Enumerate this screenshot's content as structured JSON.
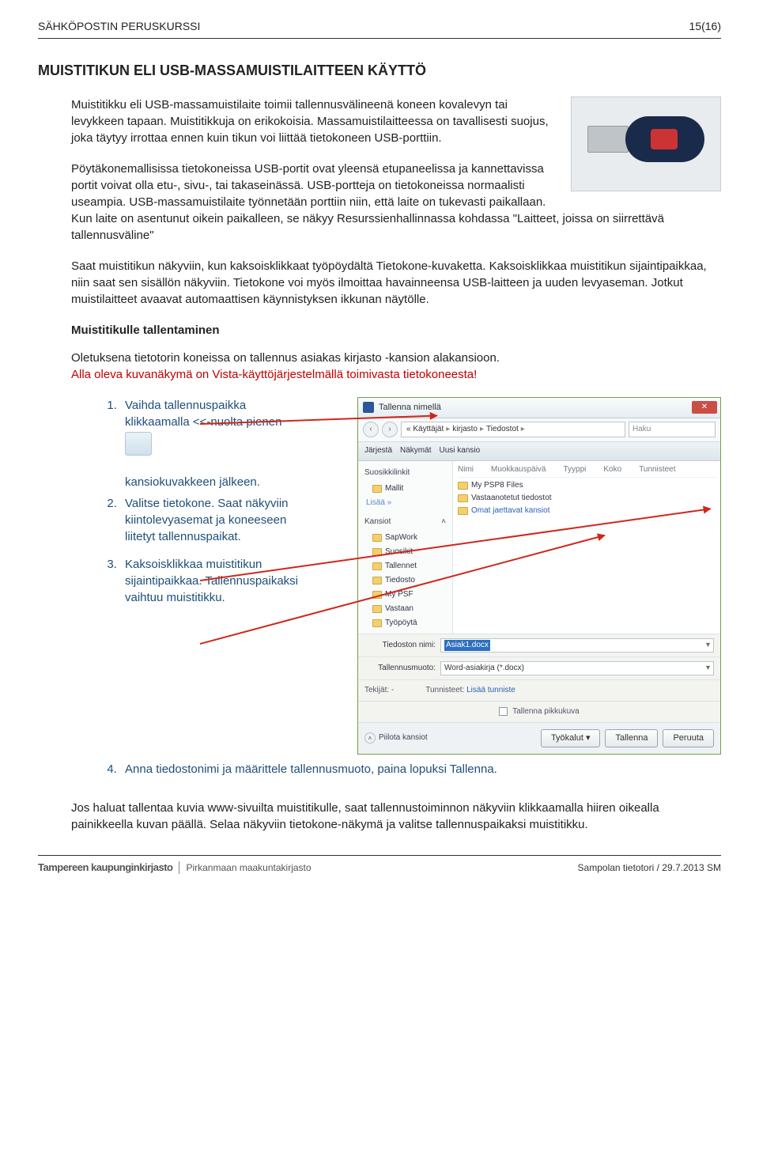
{
  "header": {
    "left": "SÄHKÖPOSTIN PERUSKURSSI",
    "right": "15(16)"
  },
  "title": "MUISTITIKUN  ELI  USB-MASSAMUISTILAITTEEN  KÄYTTÖ",
  "para1": "Muistitikku eli USB-massamuistilaite toimii tallennusvälineenä koneen kovalevyn tai levykkeen tapaan. Muistitikkuja on erikokoisia. Massamuistilaitteessa on tavallisesti suojus, joka täytyy irrottaa ennen kuin tikun voi liittää tietokoneen USB-porttiin.",
  "para2": "Pöytäkonemallisissa tietokoneissa USB-portit ovat yleensä etupaneelissa ja kannettavissa portit voivat olla etu-, sivu-, tai takaseinässä. USB-portteja on tietokoneissa normaalisti useampia. USB-massamuistilaite työnnetään porttiin niin, että laite on tukevasti paikallaan. Kun laite on asentunut oikein paikalleen, se näkyy Resurssienhallinnassa kohdassa \"Laitteet, joissa on siirrettävä tallennusväline\"",
  "para3": "Saat muistitikun näkyviin, kun kaksoisklikkaat työpöydältä Tietokone-kuvaketta. Kaksoisklikkaa muistitikun sijaintipaikkaa, niin saat sen sisällön näkyviin. Tietokone voi myös ilmoittaa havainneensa USB-laitteen ja uuden levyaseman. Jotkut muistilaitteet avaavat automaattisen käynnistyksen ikkunan näytölle.",
  "subhead": "Muistitikulle tallentaminen",
  "para4": "Oletuksena tietotorin koneissa on tallennus asiakas kirjasto -kansion alakansioon.",
  "para4_red": "Alla oleva kuvanäkymä on Vista-käyttöjärjestelmällä toimivasta tietokoneesta!",
  "steps": {
    "s1a": "Vaihda tallennuspaikka klikkaamalla  <<-nuolta  pienen",
    "s1b": "kansiokuvakkeen jälkeen.",
    "s2": "Valitse tietokone. Saat näkyviin kiintolevyasemat ja koneeseen liitetyt tallennuspaikat.",
    "s3": "Kaksoisklikkaa muistitikun sijaintipaikkaa. Tallennuspaikaksi vaihtuu muistitikku.",
    "s4": "Anna tiedostonimi ja määrittele tallennusmuoto, paina lopuksi Tallenna."
  },
  "para_last": "Jos haluat tallentaa kuvia www-sivuilta muistitikulle, saat tallennustoiminnon näkyviin klikkaamalla hiiren oikealla painikkeella kuvan päällä. Selaa näkyviin tietokone-näkymä ja valitse tallennuspaikaksi muistitikku.",
  "dialog": {
    "title": "Tallenna nimellä",
    "crumbs": [
      "« Käyttäjät",
      "kirjasto",
      "Tiedostot"
    ],
    "search": "Haku",
    "toolbar": {
      "organize": "Järjestä",
      "views": "Näkymät",
      "newfolder": "Uusi kansio"
    },
    "side": {
      "head1": "Suosikkilinkit",
      "items1": [
        "Mallit"
      ],
      "more": "Lisää  »",
      "head2": "Kansiot",
      "items2": [
        "SapWork",
        "Suosikit",
        "Tallennet",
        "Tiedosto",
        "My PSF",
        "Vastaan",
        "Työpöytä"
      ]
    },
    "columns": [
      "Nimi",
      "Muokkauspäivä",
      "Tyyppi",
      "Koko",
      "Tunnisteet"
    ],
    "folders": [
      "My PSP8 Files",
      "Vastaanotetut tiedostot",
      "Omat jaettavat kansiot"
    ],
    "file_label": "Tiedoston nimi:",
    "file_value": "Asiak1.docx",
    "type_label": "Tallennusmuoto:",
    "type_value": "Word-asiakirja (*.docx)",
    "meta_authors": "Tekijät: -",
    "meta_tags_label": "Tunnisteet:",
    "meta_tags_link": "Lisää tunniste",
    "thumb": "Tallenna pikkukuva",
    "hide": "Piilota kansiot",
    "btn_tools": "Työkalut",
    "btn_save": "Tallenna",
    "btn_cancel": "Peruuta"
  },
  "footer": {
    "logo1": "Tampereen kaupunginkirjasto",
    "logo2": "Pirkanmaan maakuntakirjasto",
    "right": "Sampolan tietotori / 29.7.2013 SM"
  }
}
